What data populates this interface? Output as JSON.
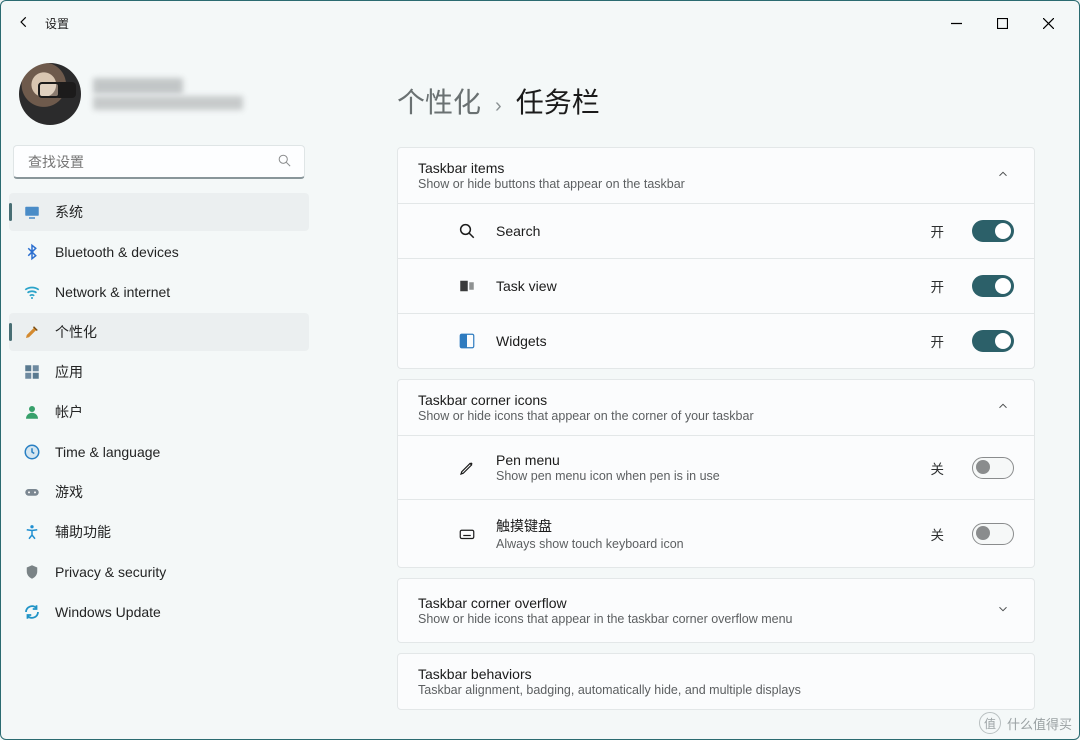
{
  "window": {
    "title": "设置"
  },
  "search": {
    "placeholder": "查找设置"
  },
  "nav": {
    "items": [
      {
        "id": "system",
        "label": "系统",
        "color": "#4a8cc7",
        "sel": true
      },
      {
        "id": "bluetooth",
        "label": "Bluetooth & devices",
        "color": "#2b6fd0",
        "sel": false
      },
      {
        "id": "network",
        "label": "Network & internet",
        "color": "#2aa3c9",
        "sel": false
      },
      {
        "id": "personalize",
        "label": "个性化",
        "color": "#d48a2f",
        "sel": true
      },
      {
        "id": "apps",
        "label": "应用",
        "color": "#4a6a80",
        "sel": false
      },
      {
        "id": "accounts",
        "label": "帐户",
        "color": "#37a06b",
        "sel": false
      },
      {
        "id": "time",
        "label": "Time & language",
        "color": "#2a81c4",
        "sel": false
      },
      {
        "id": "gaming",
        "label": "游戏",
        "color": "#7b8791",
        "sel": false
      },
      {
        "id": "access",
        "label": "辅助功能",
        "color": "#1f8fd1",
        "sel": false
      },
      {
        "id": "privacy",
        "label": "Privacy & security",
        "color": "#7a8386",
        "sel": false
      },
      {
        "id": "update",
        "label": "Windows Update",
        "color": "#1f93c6",
        "sel": false
      }
    ]
  },
  "breadcrumb": {
    "parent": "个性化",
    "current": "任务栏"
  },
  "sections": {
    "taskbar_items": {
      "title": "Taskbar items",
      "subtitle": "Show or hide buttons that appear on the taskbar",
      "rows": [
        {
          "id": "search",
          "label": "Search",
          "state": "开",
          "on": true
        },
        {
          "id": "taskview",
          "label": "Task view",
          "state": "开",
          "on": true
        },
        {
          "id": "widgets",
          "label": "Widgets",
          "state": "开",
          "on": true
        }
      ]
    },
    "corner_icons": {
      "title": "Taskbar corner icons",
      "subtitle": "Show or hide icons that appear on the corner of your taskbar",
      "rows": [
        {
          "id": "pen",
          "label": "Pen menu",
          "sub": "Show pen menu icon when pen is in use",
          "state": "关",
          "on": false
        },
        {
          "id": "touch",
          "label": "触摸键盘",
          "sub": "Always show touch keyboard icon",
          "state": "关",
          "on": false
        }
      ]
    },
    "overflow": {
      "title": "Taskbar corner overflow",
      "subtitle": "Show or hide icons that appear in the taskbar corner overflow menu"
    },
    "behaviors": {
      "title": "Taskbar behaviors",
      "subtitle": "Taskbar alignment, badging, automatically hide, and multiple displays"
    }
  },
  "watermark": {
    "text": "什么值得买",
    "badge": "值"
  }
}
